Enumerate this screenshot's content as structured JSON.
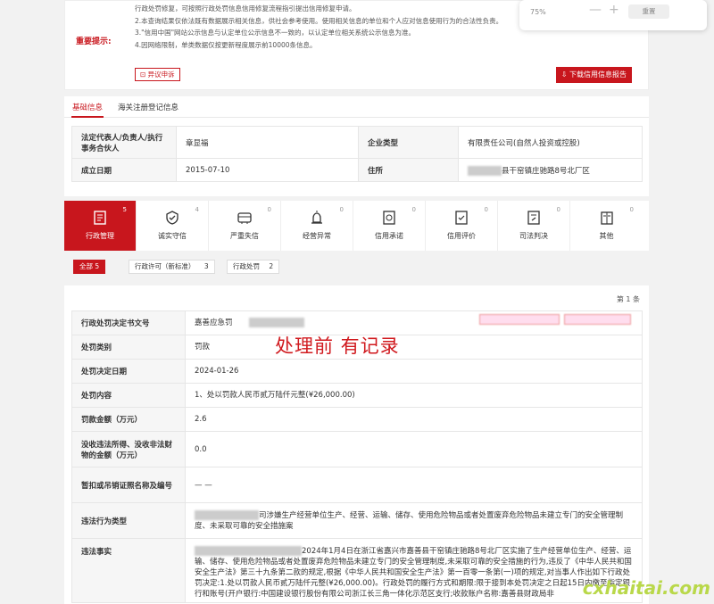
{
  "notice": {
    "label": "重要提示:",
    "lines": [
      "行政处罚修复，可按照行政处罚信息信用修复流程指引提出信用修复申请。",
      "2.本查询结果仅依法既有数据展示相关信息，供社会参考使用。使用相关信息的单位和个人应对信息使用行为的合法性负责。",
      "3.\"信用中国\"网站公示信息与认定单位公示信息不一致的，以认定单位相关系统公示信息为准。",
      "4.因网络限制，单类数据仅按更新程度展示前10000条信息。"
    ],
    "appeal_button": "异议申诉",
    "download_button": "下载信用信息报告"
  },
  "zoom": {
    "value": "75%",
    "minus": "—",
    "plus": "+",
    "reset": "重置"
  },
  "info": {
    "tabs": [
      "基础信息",
      "海关注册登记信息"
    ],
    "rows": [
      {
        "k1": "法定代表人/负责人/执行事务合伙人",
        "v1": "章显福",
        "k2": "企业类型",
        "v2": "有限责任公司(自然人投资或控股)"
      },
      {
        "k1": "成立日期",
        "v1": "2015-07-10",
        "k2": "住所",
        "v2": "县干窑镇庄驰路8号北厂区"
      }
    ]
  },
  "categories": [
    {
      "label": "行政管理",
      "count": "5",
      "icon": "admin-icon"
    },
    {
      "label": "诚实守信",
      "count": "4",
      "icon": "honesty-icon"
    },
    {
      "label": "严重失信",
      "count": "0",
      "icon": "serious-breach-icon"
    },
    {
      "label": "经营异常",
      "count": "0",
      "icon": "abnormal-icon"
    },
    {
      "label": "信用承诺",
      "count": "0",
      "icon": "commitment-icon"
    },
    {
      "label": "信用评价",
      "count": "0",
      "icon": "evaluation-icon"
    },
    {
      "label": "司法判决",
      "count": "0",
      "icon": "judgment-icon"
    },
    {
      "label": "其他",
      "count": "0",
      "icon": "other-icon"
    }
  ],
  "chips": [
    {
      "label": "全部",
      "count": "5"
    },
    {
      "label": "行政许可（新标准）",
      "count": "3"
    },
    {
      "label": "行政处罚",
      "count": "2"
    }
  ],
  "record": {
    "pager": "第 1 条",
    "rows": [
      {
        "k": "行政处罚决定书文号",
        "v": "嘉善应急罚"
      },
      {
        "k": "处罚类别",
        "v": "罚款"
      },
      {
        "k": "处罚决定日期",
        "v": "2024-01-26"
      },
      {
        "k": "处罚内容",
        "v": "1、处以罚款人民币贰万陆仟元整(¥26,000.00)"
      },
      {
        "k": "罚款金额（万元）",
        "v": "2.6"
      },
      {
        "k": "没收违法所得、没收非法财物的金额（万元）",
        "v": "0.0"
      },
      {
        "k": "暂扣或吊销证照名称及编号",
        "v": "— —"
      },
      {
        "k": "违法行为类型",
        "v": "司涉嫌生产经营单位生产、经营、运输、储存、使用危险物品或者处置废弃危险物品未建立专门的安全管理制度、未采取可靠的安全措施案"
      },
      {
        "k": "违法事实",
        "v": "2024年1月4日在浙江省嘉兴市嘉善县干窑镇庄驰路8号北厂区实施了生产经营单位生产、经营、运输、储存、使用危险物品或者处置废弃危险物品未建立专门的安全管理制度,未采取可靠的安全措施的行为,违反了《中华人民共和国安全生产法》第三十九条第二款的规定,根据《中华人民共和国安全生产法》第一百零一条第(一)项的规定,对当事人作出如下行政处罚决定:1.处以罚款人民币贰万陆仟元整(¥26,000.00)。行政处罚的履行方式和期限:限于接到本处罚决定之日起15日内缴至指定银行和账号(开户银行:中国建设银行股份有限公司浙江长三角一体化示范区支行;收款账户名称:嘉善县财政局非"
      }
    ]
  },
  "overlay_text": "处理前 有记录",
  "watermark": "cxhaitai.com"
}
